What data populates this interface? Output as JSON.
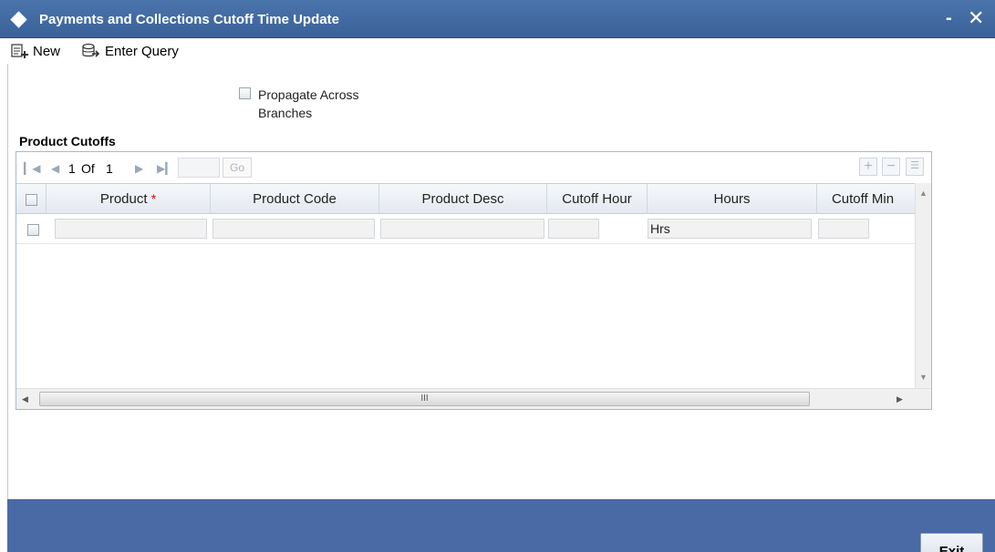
{
  "window": {
    "title": "Payments and Collections Cutoff Time Update",
    "minimize_label": "-",
    "close_label": "✕"
  },
  "toolbar": {
    "new_label": "New",
    "enter_query_label": "Enter Query"
  },
  "form": {
    "propagate_label": "Propagate Across Branches",
    "propagate_checked": false
  },
  "product_cutoffs": {
    "section_title": "Product Cutoffs",
    "pager": {
      "current": "1",
      "of_label": "Of",
      "total": "1",
      "go_label": "Go"
    },
    "columns": [
      {
        "label": "Product",
        "required": true
      },
      {
        "label": "Product Code",
        "required": false
      },
      {
        "label": "Product Desc",
        "required": false
      },
      {
        "label": "Cutoff Hour",
        "required": false
      },
      {
        "label": "Hours",
        "required": false
      },
      {
        "label": "Cutoff Min",
        "required": false
      }
    ],
    "required_marker": "*",
    "rows": [
      {
        "product": "",
        "product_code": "",
        "product_desc": "",
        "cutoff_hour": "",
        "hours": "Hrs",
        "cutoff_min": ""
      }
    ],
    "scroll_thumb_label": "III"
  },
  "footer": {
    "exit_label": "Exit"
  }
}
